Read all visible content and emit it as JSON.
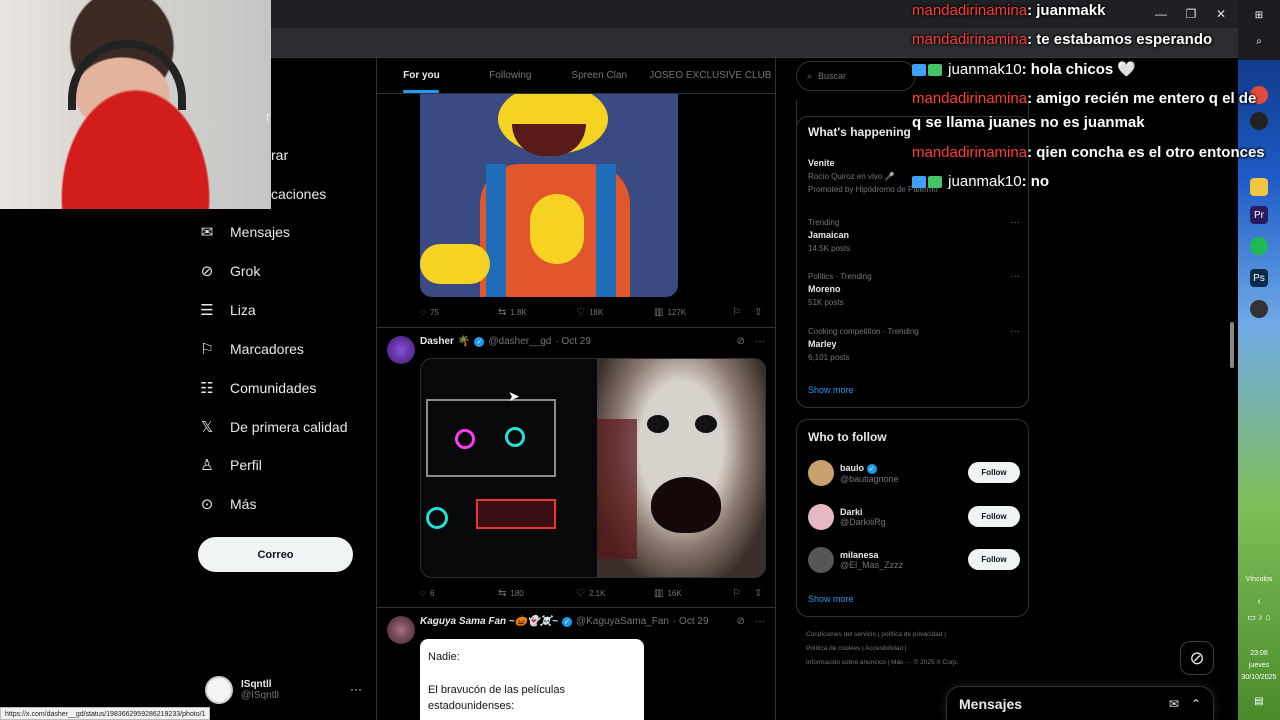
{
  "window": {
    "minimize": "—",
    "restore": "❐",
    "close": "✕"
  },
  "sidebar": {
    "partial_items": [
      {
        "label": "r",
        "top": 0
      },
      {
        "label": "rar",
        "top": 0
      },
      {
        "label": "caciones",
        "top": 0
      }
    ],
    "items": [
      {
        "label": "Mensajes",
        "icon": "mail-icon"
      },
      {
        "label": "Grok",
        "icon": "grok-icon"
      },
      {
        "label": "Liza",
        "icon": "list-icon"
      },
      {
        "label": "Marcadores",
        "icon": "bookmark-icon"
      },
      {
        "label": "Comunidades",
        "icon": "communities-icon"
      },
      {
        "label": "De primera calidad",
        "icon": "x-logo-icon"
      },
      {
        "label": "Perfil",
        "icon": "profile-icon"
      },
      {
        "label": "Más",
        "icon": "more-icon"
      }
    ],
    "post_button": "Correo",
    "account": {
      "name": "ISqntll",
      "handle": "@ISqntll",
      "more": "···"
    }
  },
  "tabs": [
    "For you",
    "Following",
    "Spreen Clan",
    "JOSEO EXCLUSIVE CLUB"
  ],
  "posts": [
    {
      "stats": {
        "replies": "75",
        "reposts": "1.8K",
        "likes": "18K",
        "views": "127K"
      }
    },
    {
      "author": "Dasher",
      "emoji": "🌴",
      "handle": "@dasher__gd",
      "date": "· Oct 29",
      "stats": {
        "replies": "6",
        "reposts": "180",
        "likes": "2.1K",
        "views": "16K"
      }
    },
    {
      "author": "Kaguya Sama Fan ~🎃👻☠️~",
      "handle": "@KaguyaSama_Fan",
      "date": "· Oct 29",
      "card_text_1": "Nadie:",
      "card_text_2": "El bravucón de las películas estadounidenses:"
    }
  ],
  "search": {
    "placeholder": "Buscar"
  },
  "whats_happening": {
    "title": "What's happening",
    "trends": [
      {
        "meta": "",
        "title": "Venite",
        "sub": "Rocío Quiroz en vivo 🎤",
        "extra": "Promoted by Hipódromo de Palermo"
      },
      {
        "meta": "Trending",
        "title": "Jamaican",
        "sub": "14.5K posts"
      },
      {
        "meta": "Politics · Trending",
        "title": "Moreno",
        "sub": "51K posts"
      },
      {
        "meta": "Cooking competition · Trending",
        "title": "Marley",
        "sub": "6,101 posts"
      }
    ],
    "show_more": "Show more"
  },
  "who_to_follow": {
    "title": "Who to follow",
    "users": [
      {
        "name": "baulo",
        "handle": "@bautiagnone",
        "button": "Follow",
        "avatar_color": "#c9a070"
      },
      {
        "name": "Darki",
        "handle": "@DarkiiiRg",
        "button": "Follow",
        "avatar_color": "#e6b8c4"
      },
      {
        "name": "milanesa",
        "handle": "@El_Mas_Zzzz",
        "button": "Follow",
        "avatar_color": "#555555"
      }
    ],
    "show_more": "Show more"
  },
  "footer": {
    "line1": "Condiciones del servicio  |  política de privacidad  |",
    "line2": "Política de cookies  |  Accesibilidad  |",
    "line3": "Información sobre anuncios  |  Más ···  © 2025 X Corp."
  },
  "messages_drawer": {
    "title": "Mensajes"
  },
  "chat": [
    {
      "user": "mandadirinamina",
      "text": ": juanmakk",
      "badges": false
    },
    {
      "user": "mandadirinamina",
      "text": ": te estabamos esperando",
      "badges": false
    },
    {
      "user": "juanmak10",
      "text": ": hola chicos 🤍",
      "badges": true
    },
    {
      "user": "mandadirinamina",
      "text": ": amigo recién me entero q el de",
      "badges": false
    },
    {
      "user": "",
      "text": "q se llama juanes no es juanmak",
      "badges": false
    },
    {
      "user": "mandadirinamina",
      "text": ": qien concha es el otro entonces",
      "badges": false
    },
    {
      "user": "juanmak10",
      "text": ": no",
      "badges": true
    }
  ],
  "taskbar": {
    "label": "Vínculos",
    "time": "23:08",
    "day": "jueves",
    "date": "30/10/2025"
  },
  "status_bar": {
    "url": "https://x.com/dasher__gd/status/1983662959286219233/photo/1"
  }
}
